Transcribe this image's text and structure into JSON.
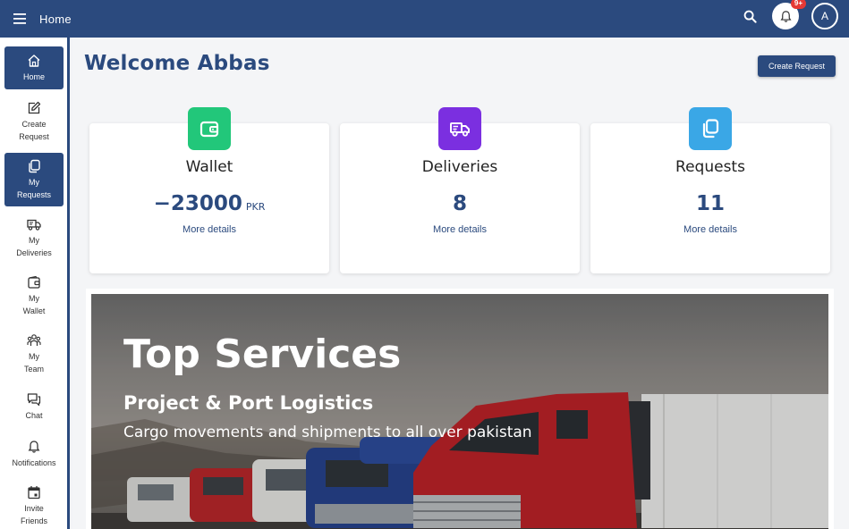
{
  "topbar": {
    "title": "Home",
    "notification_badge": "9+",
    "avatar_initial": "A",
    "bg_color": "#2b4a7e"
  },
  "sidebar": {
    "items": [
      {
        "label": "Home",
        "icon": "home-icon",
        "active": true
      },
      {
        "label": "Create\nRequest",
        "icon": "edit-icon",
        "active": false
      },
      {
        "label": "My\nRequests",
        "icon": "copy-icon",
        "active": true
      },
      {
        "label": "My\nDeliveries",
        "icon": "truck-icon",
        "active": false
      },
      {
        "label": "My\nWallet",
        "icon": "wallet-icon",
        "active": false
      },
      {
        "label": "My\nTeam",
        "icon": "team-icon",
        "active": false
      },
      {
        "label": "Chat",
        "icon": "chat-icon",
        "active": false
      },
      {
        "label": "Notifications",
        "icon": "bell-icon",
        "active": false
      },
      {
        "label": "Invite\nFriends",
        "icon": "calendar-icon",
        "active": false
      }
    ]
  },
  "main": {
    "welcome": "Welcome Abbas",
    "create_button": "Create Request",
    "cards": [
      {
        "title": "Wallet",
        "value": "−23000",
        "unit": "PKR",
        "link": "More details",
        "icon": "wallet-icon",
        "color": "#22c77a"
      },
      {
        "title": "Deliveries",
        "value": "8",
        "unit": "",
        "link": "More details",
        "icon": "truck-icon",
        "color": "#7b2fe0"
      },
      {
        "title": "Requests",
        "value": "11",
        "unit": "",
        "link": "More details",
        "icon": "copy-icon",
        "color": "#3aa7e6"
      }
    ],
    "hero": {
      "title": "Top Services",
      "subtitle": "Project & Port Logistics",
      "description": "Cargo movements and shipments to all over pakistan"
    }
  }
}
